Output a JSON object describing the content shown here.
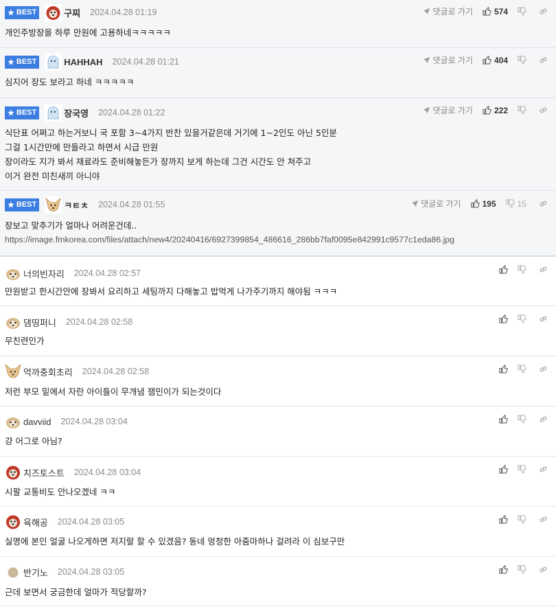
{
  "colors": {
    "best_badge": "#3b7de0",
    "best_bg": "#f5f6f8"
  },
  "labels": {
    "best": "BEST",
    "reply": "댓글로 가기"
  },
  "best_comments": [
    {
      "nick": "구찌",
      "date": "2024.04.28 01:19",
      "up": "574",
      "down": "",
      "avatar": "dog-red-avatar-icon",
      "lines": [
        "개인주방장을 하루 만원에 고용하네ㅋㅋㅋㅋㅋ"
      ]
    },
    {
      "nick": "HAHHAH",
      "date": "2024.04.28 01:21",
      "up": "404",
      "down": "",
      "avatar": "ghost-blue-avatar-icon",
      "lines": [
        "심지어 장도 보라고 하네 ㅋㅋㅋㅋㅋ"
      ]
    },
    {
      "nick": "장국영",
      "date": "2024.04.28 01:22",
      "up": "222",
      "down": "",
      "avatar": "ghost-blue-avatar-icon",
      "lines": [
        "식단표 어쩌고 하는거보니 국 포함 3~4가지 반찬 있을거같은데 거기에 1~2인도 아닌 5인분",
        "그걸 1시간만에 만들라고 하면서 시급 만원",
        "장이라도 지가 봐서 재료라도 준비해놓든가 장까지 보게 하는데 그건 시간도 안 쳐주고",
        "이거 완전 미친새끼 아니야"
      ]
    },
    {
      "nick": "ㅋㅌㅊ",
      "date": "2024.04.28 01:55",
      "up": "195",
      "down": "15",
      "avatar": "chihuahua-avatar-icon",
      "lines": [
        "장보고 맞추기가 얼마나 어려운건데..",
        "https://image.fmkorea.com/files/attach/new4/20240416/6927399854_486616_286bb7faf0095e842991c9577c1eda86.jpg"
      ]
    }
  ],
  "comments": [
    {
      "nick": "너의빈자리",
      "date": "2024.04.28 02:57",
      "avatar": "puppy-avatar-icon",
      "text": "만원받고 한시간안에 장봐서 요리하고 세팅까지 다해놓고 밥먹게 나가주기까지 해야됨 ㅋㅋㅋ"
    },
    {
      "nick": "댐띵퍼니",
      "date": "2024.04.28 02:58",
      "avatar": "puppy-avatar-icon",
      "text": "무친련인가"
    },
    {
      "nick": "억까충회초리",
      "date": "2024.04.28 02:58",
      "avatar": "chihuahua-avatar-icon",
      "text": "저런 부모 밑에서 자란 아이들이 무개념 잼민이가 되는것이다"
    },
    {
      "nick": "davviid",
      "date": "2024.04.28 03:04",
      "avatar": "puppy-avatar-icon",
      "text": "걍 어그로 아님?"
    },
    {
      "nick": "치즈토스트",
      "date": "2024.04.28 03:04",
      "avatar": "dog-red-avatar-icon",
      "text": "시팔 교통비도 안나오겠네 ㅋㅋ"
    },
    {
      "nick": "육해공",
      "date": "2024.04.28 03:05",
      "avatar": "dog-red-avatar-icon",
      "text": "실명에 본인 얼굴 나오게하면 저지랄 할 수 있겠음? 동네 멍청한 아줌마하나 걸려라 이 심보구만"
    },
    {
      "nick": "반기노",
      "date": "2024.04.28 03:05",
      "avatar": "default-circle-avatar-icon",
      "text": "근데 보면서 궁금한데 얼마가 적당할까?"
    }
  ]
}
